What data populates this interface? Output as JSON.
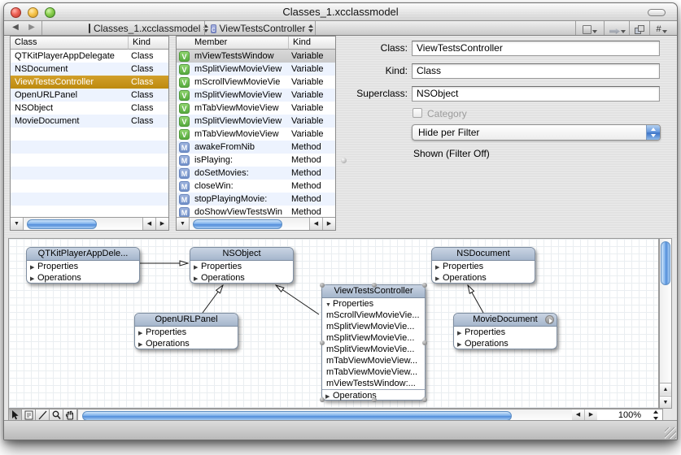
{
  "window": {
    "title": "Classes_1.xcclassmodel"
  },
  "navbar": {
    "file_popup": "Classes_1.xcclassmodel",
    "symbol_popup": "ViewTestsController",
    "symbol_icon_letter": "c",
    "hash_label": "#"
  },
  "class_list": {
    "col_class": "Class",
    "col_kind": "Kind",
    "rows": [
      {
        "name": "QTKitPlayerAppDelegate",
        "kind": "Class"
      },
      {
        "name": "NSDocument",
        "kind": "Class"
      },
      {
        "name": "ViewTestsController",
        "kind": "Class"
      },
      {
        "name": "OpenURLPanel",
        "kind": "Class"
      },
      {
        "name": "NSObject",
        "kind": "Class"
      },
      {
        "name": "MovieDocument",
        "kind": "Class"
      }
    ]
  },
  "member_list": {
    "col_member": "Member",
    "col_kind": "Kind",
    "rows": [
      {
        "badge": "V",
        "name": "mViewTestsWindow",
        "kind": "Variable"
      },
      {
        "badge": "V",
        "name": "mSplitViewMovieView",
        "kind": "Variable"
      },
      {
        "badge": "V",
        "name": "mScrollViewMovieVie",
        "kind": "Variable"
      },
      {
        "badge": "V",
        "name": "mSplitViewMovieView",
        "kind": "Variable"
      },
      {
        "badge": "V",
        "name": "mTabViewMovieView",
        "kind": "Variable"
      },
      {
        "badge": "V",
        "name": "mSplitViewMovieView",
        "kind": "Variable"
      },
      {
        "badge": "V",
        "name": "mTabViewMovieView",
        "kind": "Variable"
      },
      {
        "badge": "M",
        "name": "awakeFromNib",
        "kind": "Method"
      },
      {
        "badge": "M",
        "name": "isPlaying:",
        "kind": "Method"
      },
      {
        "badge": "M",
        "name": "doSetMovies:",
        "kind": "Method"
      },
      {
        "badge": "M",
        "name": "closeWin:",
        "kind": "Method"
      },
      {
        "badge": "M",
        "name": "stopPlayingMovie:",
        "kind": "Method"
      },
      {
        "badge": "M",
        "name": "doShowViewTestsWin",
        "kind": "Method"
      }
    ]
  },
  "inspector": {
    "class_label": "Class:",
    "class_value": "ViewTestsController",
    "kind_label": "Kind:",
    "kind_value": "Class",
    "superclass_label": "Superclass:",
    "superclass_value": "NSObject",
    "category_label": "Category",
    "filter_value": "Hide per Filter",
    "filter_status": "Shown (Filter Off)"
  },
  "diagram": {
    "properties_label": "Properties",
    "operations_label": "Operations",
    "boxes": {
      "qtkit": {
        "title": "QTKitPlayerAppDele..."
      },
      "nsobject": {
        "title": "NSObject"
      },
      "nsdocument": {
        "title": "NSDocument"
      },
      "openurl": {
        "title": "OpenURLPanel"
      },
      "moviedoc": {
        "title": "MovieDocument"
      },
      "vtc": {
        "title": "ViewTestsController",
        "properties": [
          "mScrollViewMovieVie...",
          "mSplitViewMovieVie...",
          "mSplitViewMovieVie...",
          "mSplitViewMovieVie...",
          "mTabViewMovieView...",
          "mTabViewMovieView...",
          "mViewTestsWindow:..."
        ]
      }
    }
  },
  "statusbar": {
    "zoom": "100%"
  },
  "colors": {
    "selection_gold": "#c2940e",
    "row_stripe": "#edf3fe",
    "aqua_blue": "#5e97dd",
    "box_header": "#b3c2d6"
  }
}
